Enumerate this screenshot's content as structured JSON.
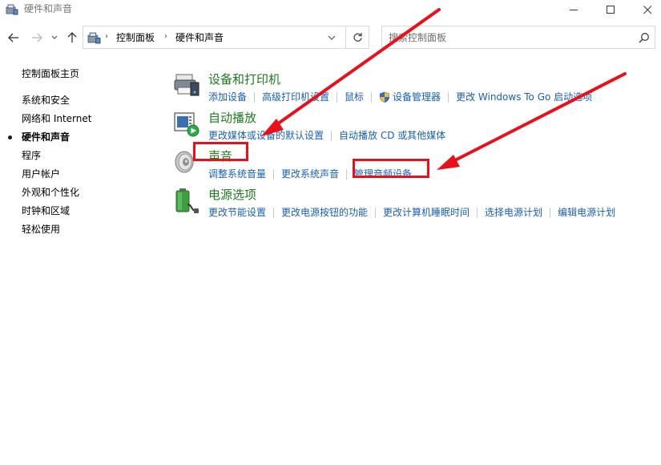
{
  "window": {
    "title": "硬件和声音",
    "icon": "control-panel-icon",
    "buttons": [
      "minimize-icon",
      "maximize-icon",
      "close-icon"
    ]
  },
  "navigation": {
    "back_icon": "arrow-left-icon",
    "forward_icon": "arrow-right-icon",
    "recent_icon": "chevron-down-icon",
    "up_icon": "arrow-up-icon",
    "breadcrumb": [
      "控制面板",
      "硬件和声音"
    ],
    "refresh_icon": "refresh-icon",
    "search": {
      "placeholder": "搜索控制面板",
      "value": ""
    }
  },
  "sidebar": {
    "items": [
      {
        "label": "控制面板主页",
        "current": false
      },
      {
        "label": "系统和安全",
        "current": false
      },
      {
        "label": "网络和 Internet",
        "current": false
      },
      {
        "label": "硬件和声音",
        "current": true
      },
      {
        "label": "程序",
        "current": false
      },
      {
        "label": "用户帐户",
        "current": false
      },
      {
        "label": "外观和个性化",
        "current": false
      },
      {
        "label": "时钟和区域",
        "current": false
      },
      {
        "label": "轻松使用",
        "current": false
      }
    ]
  },
  "categories": [
    {
      "title": "设备和打印机",
      "icon": "printer-icon",
      "links": [
        "添加设备",
        "高级打印机设置",
        "鼠标",
        "设备管理器",
        "更改 Windows To Go 启动选项"
      ],
      "shield_on_link": 3
    },
    {
      "title": "自动播放",
      "icon": "autoplay-icon",
      "links": [
        "更改媒体或设备的默认设置",
        "自动播放 CD 或其他媒体"
      ]
    },
    {
      "title": "声音",
      "icon": "speaker-icon",
      "links": [
        "调整系统音量",
        "更改系统声音",
        "管理音频设备"
      ]
    },
    {
      "title": "电源选项",
      "icon": "battery-icon",
      "links": [
        "更改节能设置",
        "更改电源按钮的功能",
        "更改计算机睡眠时间",
        "选择电源计划",
        "编辑电源计划"
      ]
    }
  ],
  "colors": {
    "category_title": "#1e7a1e",
    "link": "#1a5fb4",
    "annotation": "#e8101a"
  }
}
